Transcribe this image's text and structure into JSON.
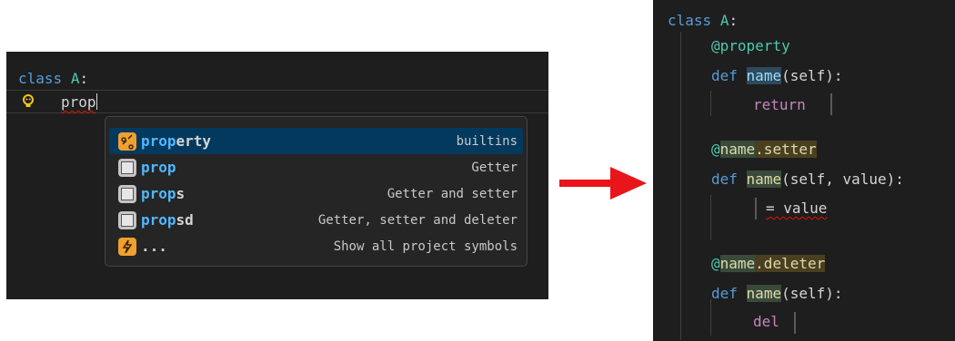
{
  "left": {
    "line1": {
      "keyword": "class",
      "name": "A",
      "colon": ":"
    },
    "line2": {
      "typed": "prop"
    },
    "bulb_icon": "lightbulb-icon"
  },
  "suggestions": [
    {
      "match": "prop",
      "rest": "erty",
      "detail": "builtins",
      "icon": "property-icon",
      "selected": true
    },
    {
      "match": "prop",
      "rest": "",
      "detail": "Getter",
      "icon": "snippet-icon",
      "selected": false
    },
    {
      "match": "prop",
      "rest": "s",
      "detail": "Getter and setter",
      "icon": "snippet-icon",
      "selected": false
    },
    {
      "match": "prop",
      "rest": "sd",
      "detail": "Getter, setter and deleter",
      "icon": "snippet-icon",
      "selected": false
    },
    {
      "match": "",
      "rest": "...",
      "detail": "Show all project symbols",
      "icon": "lightning-icon",
      "selected": false
    }
  ],
  "right": {
    "class_kw": "class",
    "class_name": "A",
    "colon": ":",
    "at": "@",
    "property": "property",
    "def": "def",
    "name": "name",
    "self_sig": "(self):",
    "return_kw": "return",
    "setter": ".setter",
    "setter_sig": "(self, value):",
    "setter_body": "= value",
    "deleter": ".deleter",
    "del_kw": "del"
  },
  "colors": {
    "arrow": "#e8151b",
    "editor_bg": "#1e1e1e",
    "selected_row": "#04395e"
  }
}
